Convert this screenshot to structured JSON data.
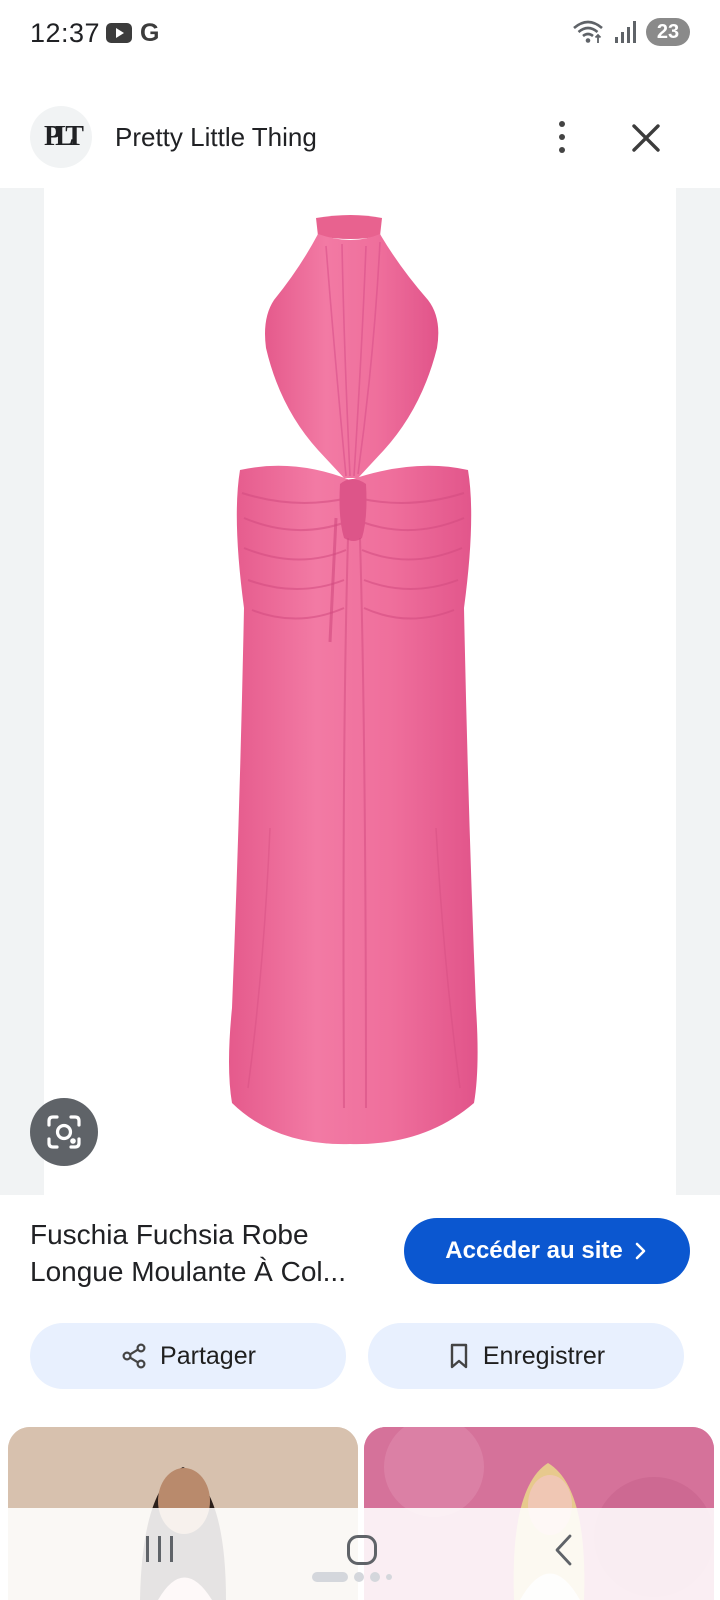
{
  "status_bar": {
    "time": "12:37",
    "left_icons": [
      "youtube-icon",
      "google-icon"
    ],
    "right_icons": [
      "wifi-icon",
      "signal-icon"
    ],
    "battery": "23"
  },
  "header": {
    "logo_text": "PLT",
    "site_name": "Pretty Little Thing",
    "more_icon": "more-vert-icon",
    "close_icon": "close-icon"
  },
  "image": {
    "subject": "pink halter-neck ruched maxi dress",
    "dress_color": "#ee6a99",
    "lens_icon": "google-lens-icon"
  },
  "product": {
    "title_line1": "Fuschia Fuchsia Robe",
    "title_line2": "Longue Moulante À Col...",
    "visit_label": "Accéder au site",
    "share_label": "Partager",
    "save_label": "Enregistrer"
  },
  "colors": {
    "accent": "#0b57d0",
    "chip_bg": "#e8f0fe",
    "dress": "#ee6a99"
  },
  "navigation": {
    "buttons": [
      "recent-apps",
      "home",
      "back"
    ]
  }
}
